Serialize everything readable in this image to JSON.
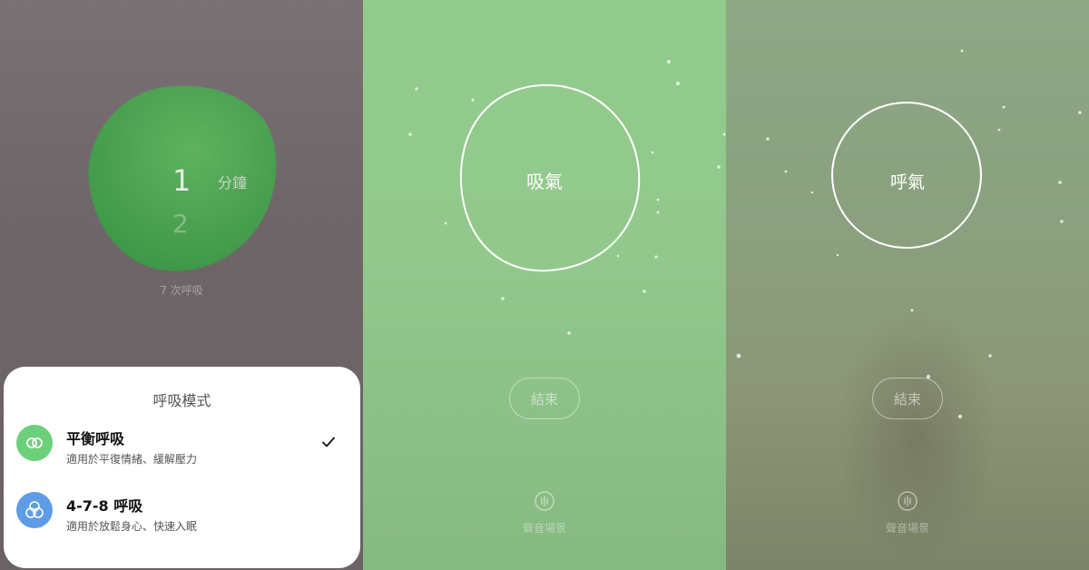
{
  "duration_picker": {
    "selected": "1",
    "next": "2",
    "unit": "分鐘",
    "breath_count": "7 次呼吸"
  },
  "mode_sheet": {
    "title": "呼吸模式",
    "modes": [
      {
        "title": "平衡呼吸",
        "description": "適用於平復情緒、緩解壓力",
        "icon": "interlocking-rings-icon",
        "icon_color": "#6ccf7a",
        "selected": true
      },
      {
        "title": "4-7-8 呼吸",
        "description": "適用於放鬆身心、快速入眠",
        "icon": "overlapping-circles-icon",
        "icon_color": "#5e9ce6",
        "selected": false
      }
    ]
  },
  "inhale_screen": {
    "phase": "吸氣",
    "end_button": "結束",
    "sound_label": "聲音場景",
    "background": "#93cb8d"
  },
  "exhale_screen": {
    "phase": "呼氣",
    "end_button": "結束",
    "sound_label": "聲音場景",
    "background": "#8aa07f"
  },
  "colors": {
    "blob": "#3f9f4a",
    "sheet_bg": "#ffffff"
  }
}
